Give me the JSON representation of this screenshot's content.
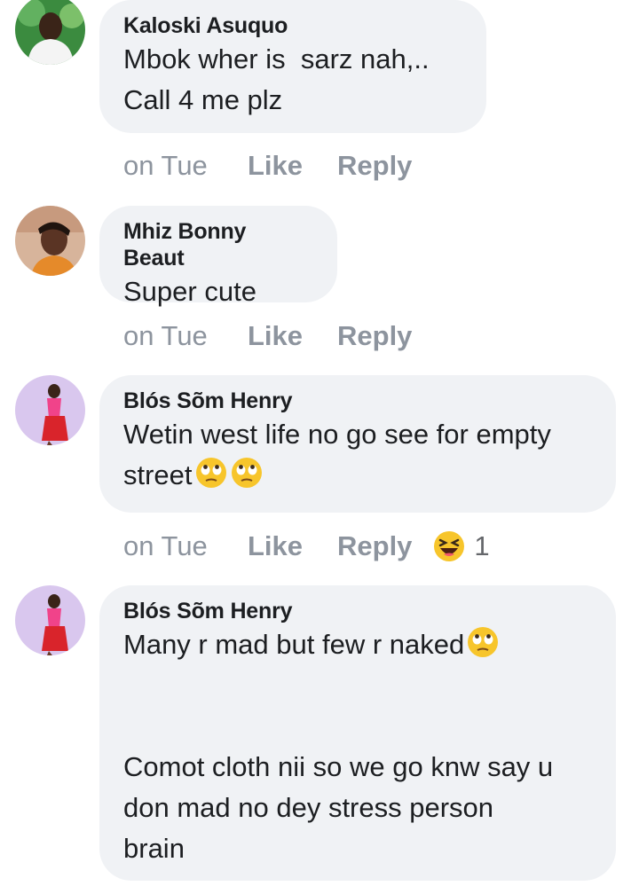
{
  "comments": [
    {
      "author": "Kaloski Asuquo",
      "lines": [
        "Mbok wher is  sarz nah,..",
        "Call 4 me plz"
      ],
      "time": "on Tue",
      "like": "Like",
      "reply": "Reply"
    },
    {
      "author": "Mhiz Bonny Beaut",
      "lines": [
        "Super cute"
      ],
      "time": "on Tue",
      "like": "Like",
      "reply": "Reply"
    },
    {
      "author": "Blós Sõm Henry",
      "lines": [
        "Wetin west life no go see for empty",
        "street"
      ],
      "emoji": [
        "face-with-rolling-eyes-icon",
        "face-with-rolling-eyes-icon"
      ],
      "time": "on Tue",
      "like": "Like",
      "reply": "Reply",
      "reaction": {
        "icon": "haha-reaction-icon",
        "count": "1"
      }
    },
    {
      "author": "Blós Sõm Henry",
      "lines": [
        "Many r mad but few r naked",
        "",
        "",
        "Comot cloth nii so we go knw say u",
        "don mad no dey stress person",
        "brain"
      ],
      "emoji": [
        "face-with-rolling-eyes-icon"
      ]
    }
  ],
  "colors": {
    "bubble": "#f0f2f5",
    "text": "#1c1e21",
    "meta": "#8d949e",
    "emoji_yellow": "#f7c52b"
  }
}
